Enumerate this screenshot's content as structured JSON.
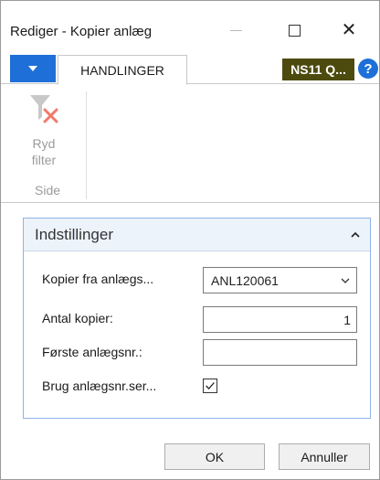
{
  "window": {
    "title": "Rediger - Kopier anlæg",
    "controls": {
      "minimize_icon": "minimize-icon",
      "maximize_icon": "maximize-icon",
      "close_icon": "close-icon",
      "close_glyph": "✕"
    }
  },
  "ribbon": {
    "menu_icon": "dropdown-caret-icon",
    "active_tab": "HANDLINGER",
    "company_badge": "NS11 Q...",
    "help_glyph": "?",
    "buttons": [
      {
        "label_line1": "Ryd",
        "label_line2": "filter",
        "icon": "clear-filter-icon",
        "enabled": false
      }
    ],
    "group_label": "Side"
  },
  "settings": {
    "title": "Indstillinger",
    "collapse_icon": "chevron-up-icon",
    "fields": [
      {
        "label": "Kopier fra anlægs...",
        "value": "ANL120061",
        "type": "dropdown"
      },
      {
        "label": "Antal kopier:",
        "value": "1",
        "type": "number"
      },
      {
        "label": "Første anlægsnr.:",
        "value": "",
        "type": "text"
      },
      {
        "label": "Brug anlægsnr.ser...",
        "checked": true,
        "type": "checkbox"
      }
    ]
  },
  "footer": {
    "ok_label": "OK",
    "cancel_label": "Annuller"
  },
  "colors": {
    "accent_blue": "#1e6fd8",
    "company_badge_bg": "#4d4a0e",
    "fasttab_border": "#8fb3e8",
    "fasttab_header_bg": "#edf3fb",
    "disabled_text": "#9b9b9b",
    "clear_filter_x": "#f07a6a"
  }
}
